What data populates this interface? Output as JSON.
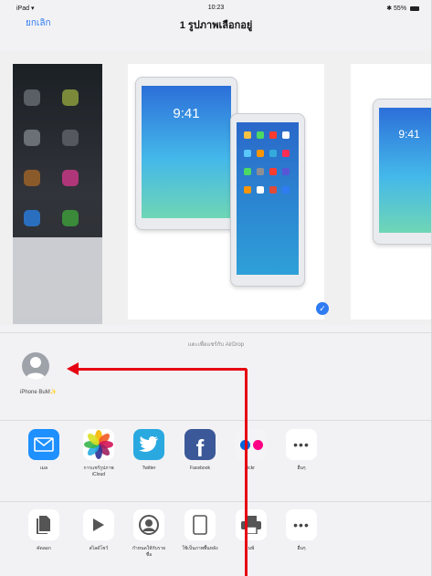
{
  "status_bar": {
    "device": "iPad",
    "time": "10:23",
    "battery": "55%"
  },
  "nav": {
    "cancel_label": "ยกเลิก",
    "title": "1 รูปภาพเลือกอยู่"
  },
  "preview": {
    "clock": "9:41",
    "selected_mark": "✓"
  },
  "airdrop": {
    "caption": "แตะเพื่อแชร์กับ AirDrop",
    "device_name": "iPhone BuM",
    "device_name_suffix": "✨"
  },
  "share_row": [
    {
      "label": "เมล",
      "icon": "mail-icon"
    },
    {
      "label": "การแชร์รูปภาพ iCloud",
      "icon": "photos-icon"
    },
    {
      "label": "Twitter",
      "icon": "twitter-icon"
    },
    {
      "label": "Facebook",
      "icon": "facebook-icon"
    },
    {
      "label": "ickr",
      "icon": "flickr-icon"
    },
    {
      "label": "อื่นๆ",
      "icon": "more-icon"
    }
  ],
  "action_row": [
    {
      "label": "คัดลอก",
      "icon": "copy-icon"
    },
    {
      "label": "สไลด์โชว์",
      "icon": "slideshow-icon"
    },
    {
      "label": "กำหนดให้กับรายชื่อ",
      "icon": "contact-icon"
    },
    {
      "label": "ใช้เป็นภาพพื้นหลัง",
      "icon": "wallpaper-icon"
    },
    {
      "label": "มพ์",
      "icon": "print-icon"
    },
    {
      "label": "อื่นๆ",
      "icon": "more-icon"
    }
  ],
  "colors": {
    "accent": "#2f7bf2",
    "annotation": "#e60012",
    "mail": "#1e90ff",
    "twitter": "#2aa9e0",
    "facebook": "#3b5998"
  }
}
